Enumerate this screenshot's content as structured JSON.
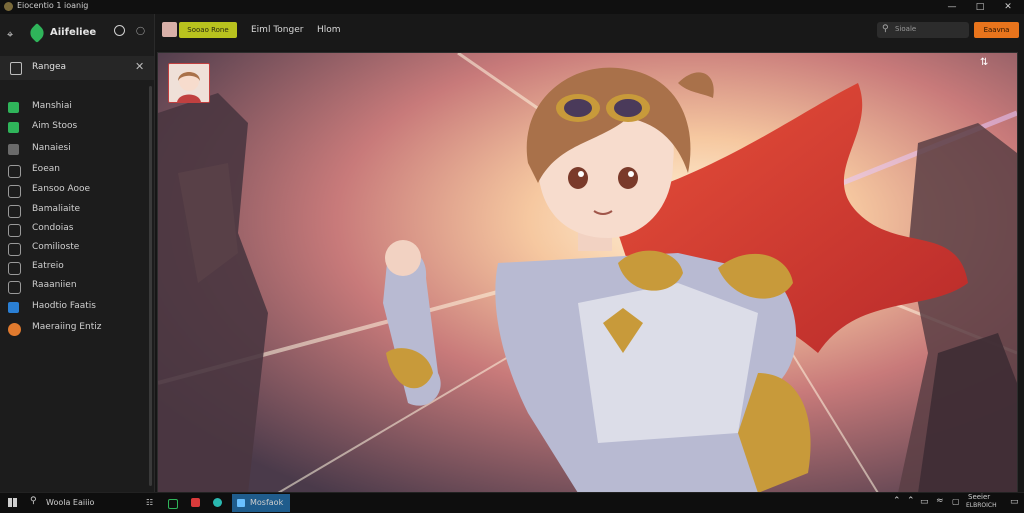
{
  "window": {
    "title": "Eiocentio 1 ioanig"
  },
  "sidebar": {
    "app_name": "Aiifeliee",
    "search_label": "Rangea",
    "items": [
      {
        "label": "Manshiai",
        "icon": "green-square-icon",
        "color": "#2fb45a"
      },
      {
        "label": "Aim Stoos",
        "icon": "green-square-icon",
        "color": "#2fb45a"
      },
      {
        "label": "Nanaiesi",
        "icon": "gray-square-icon",
        "color": "#6a6a6a"
      },
      {
        "label": "Eoean",
        "icon": "gear-icon",
        "color": "#9a9a9a"
      },
      {
        "label": "Eansoo Aooe",
        "icon": "clock-icon",
        "color": "#9a9a9a"
      },
      {
        "label": "Bamaliaite",
        "icon": "refresh-icon",
        "color": "#9a9a9a"
      },
      {
        "label": "Condoias",
        "icon": "nodes-icon",
        "color": "#9a9a9a"
      },
      {
        "label": "Comilioste",
        "icon": "circle-arrow-icon",
        "color": "#9a9a9a"
      },
      {
        "label": "Eatreio",
        "icon": "globe-icon",
        "color": "#9a9a9a"
      },
      {
        "label": "Raaaniien",
        "icon": "image-icon",
        "color": "#9a9a9a"
      },
      {
        "label": "Haodtio Faatis",
        "icon": "blue-square-icon",
        "color": "#2a7fd4"
      },
      {
        "label": "Maeraiing Entiz",
        "icon": "orange-orb-icon",
        "color": "#e07a2e",
        "label2_color": "#e08a2e"
      }
    ]
  },
  "toolbar": {
    "badge_label": "Sooao Rone",
    "tabs": [
      "Eiml Tonger",
      "Hlom"
    ],
    "search_placeholder": "Sioale",
    "action_label": "Eaavna"
  },
  "taskbar": {
    "search_text": "Woola Eaiiio",
    "active_app": "Mosfaok",
    "clock_line1": "Seeier",
    "clock_line2": "ELBROICH"
  },
  "colors": {
    "accent_green": "#2fb45a",
    "badge_yellow": "#b8c21e",
    "action_orange": "#e8741c",
    "task_active": "#1f5c8c"
  }
}
